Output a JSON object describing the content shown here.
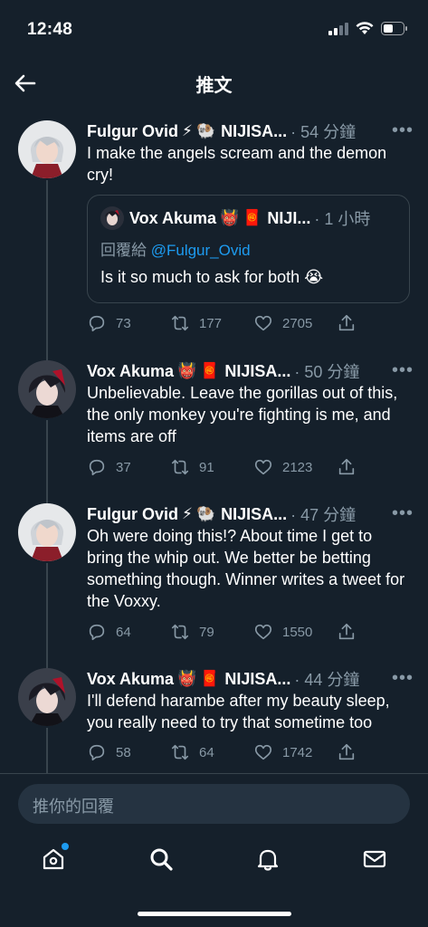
{
  "status": {
    "time": "12:48"
  },
  "header": {
    "title": "推文"
  },
  "tweets": [
    {
      "name": "Fulgur Ovid",
      "emoji1": "⚡",
      "emoji2": "🐏",
      "handle_trunc": "NIJISA...",
      "time": "· 54 分鐘",
      "more": "•••",
      "text": "I make the angels scream and the demon cry!",
      "replies": "73",
      "retweets": "177",
      "likes": "2705",
      "quote": {
        "name": "Vox Akuma",
        "emoji1": "👹",
        "emoji2": "🧧",
        "handle_trunc": "NIJI...",
        "time": "· 1 小時",
        "reply_prefix": "回覆給",
        "reply_to": "@Fulgur_Ovid",
        "text": "Is it so much to ask for both 😭"
      }
    },
    {
      "name": "Vox Akuma",
      "emoji1": "👹",
      "emoji2": "🧧",
      "handle_trunc": "NIJISA...",
      "time": "· 50 分鐘",
      "more": "•••",
      "text": "Unbelievable. Leave the gorillas out of this, the only monkey you're fighting is me, and items are off",
      "replies": "37",
      "retweets": "91",
      "likes": "2123"
    },
    {
      "name": "Fulgur Ovid",
      "emoji1": "⚡",
      "emoji2": "🐏",
      "handle_trunc": "NIJISA...",
      "time": "· 47 分鐘",
      "more": "•••",
      "text": "Oh were doing this!? About time I get to bring the whip out. We better be betting something though. Winner writes a tweet for the Voxxy.",
      "replies": "64",
      "retweets": "79",
      "likes": "1550"
    },
    {
      "name": "Vox Akuma",
      "emoji1": "👹",
      "emoji2": "🧧",
      "handle_trunc": "NIJISA...",
      "time": "· 44 分鐘",
      "more": "•••",
      "text": "I'll defend harambe after my beauty sleep, you really need to try that sometime too",
      "replies": "58",
      "retweets": "64",
      "likes": "1742"
    }
  ],
  "compose": {
    "placeholder": "推你的回覆"
  },
  "colors": {
    "background": "#15202b",
    "accent": "#1d9bf0",
    "muted": "#8899a6",
    "border": "#38444d"
  }
}
